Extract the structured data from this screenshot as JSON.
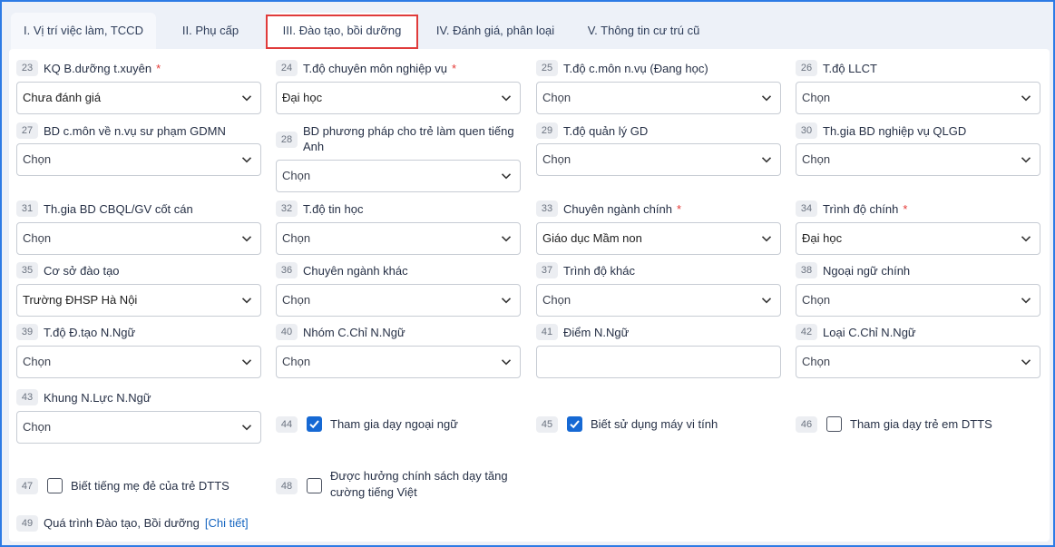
{
  "tabs": [
    {
      "label": "I. Vị trí việc làm, TCCD"
    },
    {
      "label": "II. Phụ cấp"
    },
    {
      "label": "III. Đào tạo, bồi dưỡng"
    },
    {
      "label": "IV. Đánh giá, phân loại"
    },
    {
      "label": "V. Thông tin cư trú cũ"
    }
  ],
  "fields": {
    "f23": {
      "num": "23",
      "label": "KQ B.dưỡng t.xuyên",
      "required": "*",
      "value": "Chưa đánh giá"
    },
    "f24": {
      "num": "24",
      "label": "T.độ chuyên môn nghiệp vụ",
      "required": "*",
      "value": "Đại học"
    },
    "f25": {
      "num": "25",
      "label": "T.độ c.môn n.vụ (Đang học)",
      "value": "Chọn"
    },
    "f26": {
      "num": "26",
      "label": "T.độ LLCT",
      "value": "Chọn"
    },
    "f27": {
      "num": "27",
      "label": "BD c.môn về n.vụ sư phạm GDMN",
      "value": "Chọn"
    },
    "f28": {
      "num": "28",
      "label_line1": "BD phương pháp cho trẻ làm quen tiếng",
      "label_line2": "Anh",
      "value": "Chọn"
    },
    "f29": {
      "num": "29",
      "label": "T.độ quản lý GD",
      "value": "Chọn"
    },
    "f30": {
      "num": "30",
      "label": "Th.gia BD nghiệp vụ QLGD",
      "value": "Chọn"
    },
    "f31": {
      "num": "31",
      "label": "Th.gia BD CBQL/GV cốt cán",
      "value": "Chọn"
    },
    "f32": {
      "num": "32",
      "label": "T.độ tin học",
      "value": "Chọn"
    },
    "f33": {
      "num": "33",
      "label": "Chuyên ngành chính",
      "required": "*",
      "value": "Giáo dục Mầm non"
    },
    "f34": {
      "num": "34",
      "label": "Trình độ chính",
      "required": "*",
      "value": "Đại học"
    },
    "f35": {
      "num": "35",
      "label": "Cơ sở đào tạo",
      "value": "Trường ĐHSP Hà Nội"
    },
    "f36": {
      "num": "36",
      "label": "Chuyên ngành khác",
      "value": "Chọn"
    },
    "f37": {
      "num": "37",
      "label": "Trình độ khác",
      "value": "Chọn"
    },
    "f38": {
      "num": "38",
      "label": "Ngoại ngữ chính",
      "value": "Chọn"
    },
    "f39": {
      "num": "39",
      "label": "T.độ Đ.tạo N.Ngữ",
      "value": "Chọn"
    },
    "f40": {
      "num": "40",
      "label": "Nhóm C.Chỉ N.Ngữ",
      "value": "Chọn"
    },
    "f41": {
      "num": "41",
      "label": "Điểm N.Ngữ",
      "value": ""
    },
    "f42": {
      "num": "42",
      "label": "Loại C.Chỉ N.Ngữ",
      "value": "Chọn"
    },
    "f43": {
      "num": "43",
      "label": "Khung N.Lực N.Ngữ",
      "value": "Chọn"
    },
    "f44": {
      "num": "44",
      "label": "Tham gia dạy ngoại ngữ",
      "checked": true
    },
    "f45": {
      "num": "45",
      "label": "Biết sử dụng máy vi tính",
      "checked": true
    },
    "f46": {
      "num": "46",
      "label": "Tham gia dạy trẻ em DTTS",
      "checked": false
    },
    "f47": {
      "num": "47",
      "label": "Biết tiếng mẹ đẻ của trẻ DTTS",
      "checked": false
    },
    "f48": {
      "num": "48",
      "label_line1": "Được hưởng chính sách dạy tăng",
      "label_line2": "cường tiếng Việt",
      "checked": false
    },
    "f49": {
      "num": "49",
      "label": "Quá trình Đào tạo, Bồi dưỡng",
      "link": "[Chi tiết]"
    }
  },
  "colors": {
    "accent": "#1669d4",
    "highlight": "#e03b3b",
    "frame": "#2d7be5",
    "required": "#e53935"
  },
  "icons": {
    "dropdown": "chevron-down-icon",
    "checkbox_checked": "check-icon"
  }
}
